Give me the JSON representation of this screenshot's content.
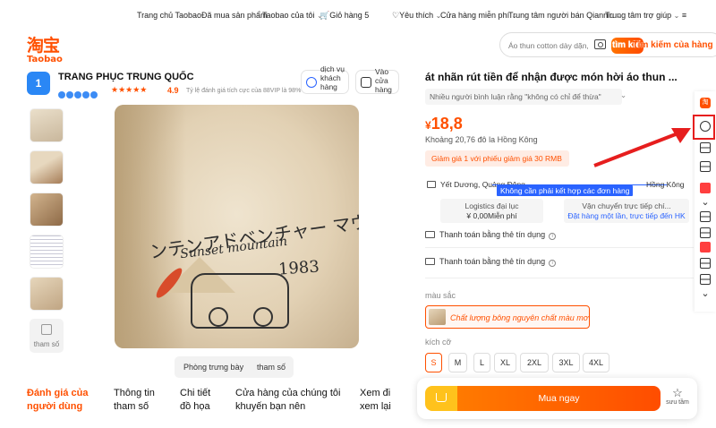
{
  "topnav": {
    "home": "Trang chủ Taobao",
    "bought": "Đã mua sản phẩm",
    "my_taobao": "Taobao của tôi",
    "cart": "Giỏ hàng",
    "cart_count": "5",
    "favorites": "Yêu thích",
    "free_store": "Cửa hàng miễn phí",
    "seller_center": "Trung tâm người bán Qianniu",
    "help_center": "Trung tâm trợ giúp",
    "more": "≡"
  },
  "logo": {
    "cn": "淘宝",
    "en": "Taobao"
  },
  "search": {
    "placeholder": "Áo thun cotton dày dặn,",
    "button_label": "tìm kiếm",
    "shop_search": "Tìm kiếm của hàng này"
  },
  "store": {
    "name": "TRANG PHỤC TRUNG QUỐC",
    "avatar_text": "1",
    "stars": "★★★★★",
    "score": "4.9",
    "repurchase": "Tỷ lệ đánh giá tích cực của 88VIP là 98%",
    "service_label": "dịch vụ khách hàng",
    "enter_store_label": "Vào cửa hàng"
  },
  "gallery": {
    "params_thumb": "tham số",
    "print_jp": "ンテンアドベンチャー マウン",
    "print_en": "Sunset mountain",
    "print_year": "1983",
    "btn_display": "Phòng trưng bày",
    "btn_params": "tham số"
  },
  "tabs": [
    {
      "label": "Đánh giá của người dùng",
      "active": true
    },
    {
      "label": "Thông tin tham số",
      "active": false
    },
    {
      "label": "Chi tiết đồ họa",
      "active": false
    },
    {
      "label": "Cửa hàng của chúng tôi khuyến bạn nên",
      "active": false
    },
    {
      "label": "Xem đi xem lại",
      "active": false
    }
  ],
  "product": {
    "title": "át nhãn rút tiền để nhận được món hời áo thun ...",
    "review_tag": "Nhiều người bình luận rằng \"không có chỉ để thừa\"",
    "currency": "¥",
    "price": "18,8",
    "hkd": "Khoảng 20,76 đô la Hồng Kông",
    "coupon": "Giảm giá 1 với phiếu giảm giá 30 RMB"
  },
  "shipping": {
    "from": "Yết Dương, Quảng Đông",
    "to": "Hồng Kông",
    "banner": "Không cần phải kết hợp các đơn hàng",
    "agent_title": "Logistics đại lục",
    "agent_value": "¥ 0,00Miễn phí",
    "direct_title": "Vận chuyển trực tiếp chí...",
    "direct_value": "Đặt hàng một lần, trực tiếp đến HK"
  },
  "payment": {
    "row1": "Thanh toán bằng thẻ tín dụng",
    "row2": "Thanh toán bằng thẻ tín dụng",
    "info": "i"
  },
  "options": {
    "color_label": "màu sắc",
    "color_value": "Chất lượng bông nguyên chất màu mơ",
    "size_label": "kích cỡ",
    "sizes": [
      "S",
      "M",
      "L",
      "XL",
      "2XL",
      "3XL",
      "4XL"
    ],
    "selected_size": "S"
  },
  "buybar": {
    "buy_now": "Mua ngay",
    "favorite": "sưu tầm",
    "fav_star": "☆"
  },
  "sidebar": {
    "top_icon": "淘"
  },
  "colors": {
    "accent": "#ff5000",
    "blue": "#2a63ff",
    "highlight": "#e61e1e"
  }
}
